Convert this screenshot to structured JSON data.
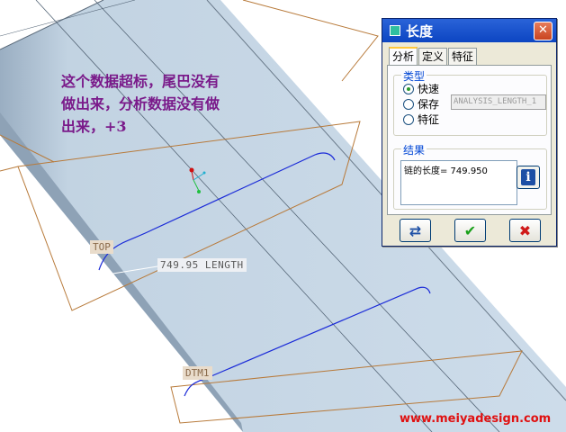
{
  "viewport": {
    "datum_top": "TOP",
    "datum_dtm1": "DTM1",
    "dimension_label": "749.95 LENGTH",
    "note_line1": "这个数据超标，尾巴没有",
    "note_line2": "做出来，分析数据没有做",
    "note_line3": "出来，+3",
    "watermark": "www.meiyadesign.com"
  },
  "dialog": {
    "title": "长度",
    "tabs": [
      {
        "label": "分析",
        "active": true
      },
      {
        "label": "定义",
        "active": false
      },
      {
        "label": "特征",
        "active": false
      }
    ],
    "type_group": {
      "title": "类型",
      "options": [
        {
          "label": "快速",
          "selected": true
        },
        {
          "label": "保存",
          "selected": false
        },
        {
          "label": "特征",
          "selected": false
        }
      ],
      "save_name": "ANALYSIS_LENGTH_1"
    },
    "result_group": {
      "title": "结果",
      "text": "链的长度= 749.950"
    },
    "buttons": {
      "repeat_icon": "repeat-arrows-icon",
      "ok_icon": "green-check-icon",
      "cancel_icon": "red-x-icon"
    }
  },
  "colors": {
    "surface": "#c6d6e4",
    "datum_plane": "#b87a3a",
    "curve": "#1a2ad8",
    "note": "#7a1a8a",
    "watermark": "#e01010"
  }
}
